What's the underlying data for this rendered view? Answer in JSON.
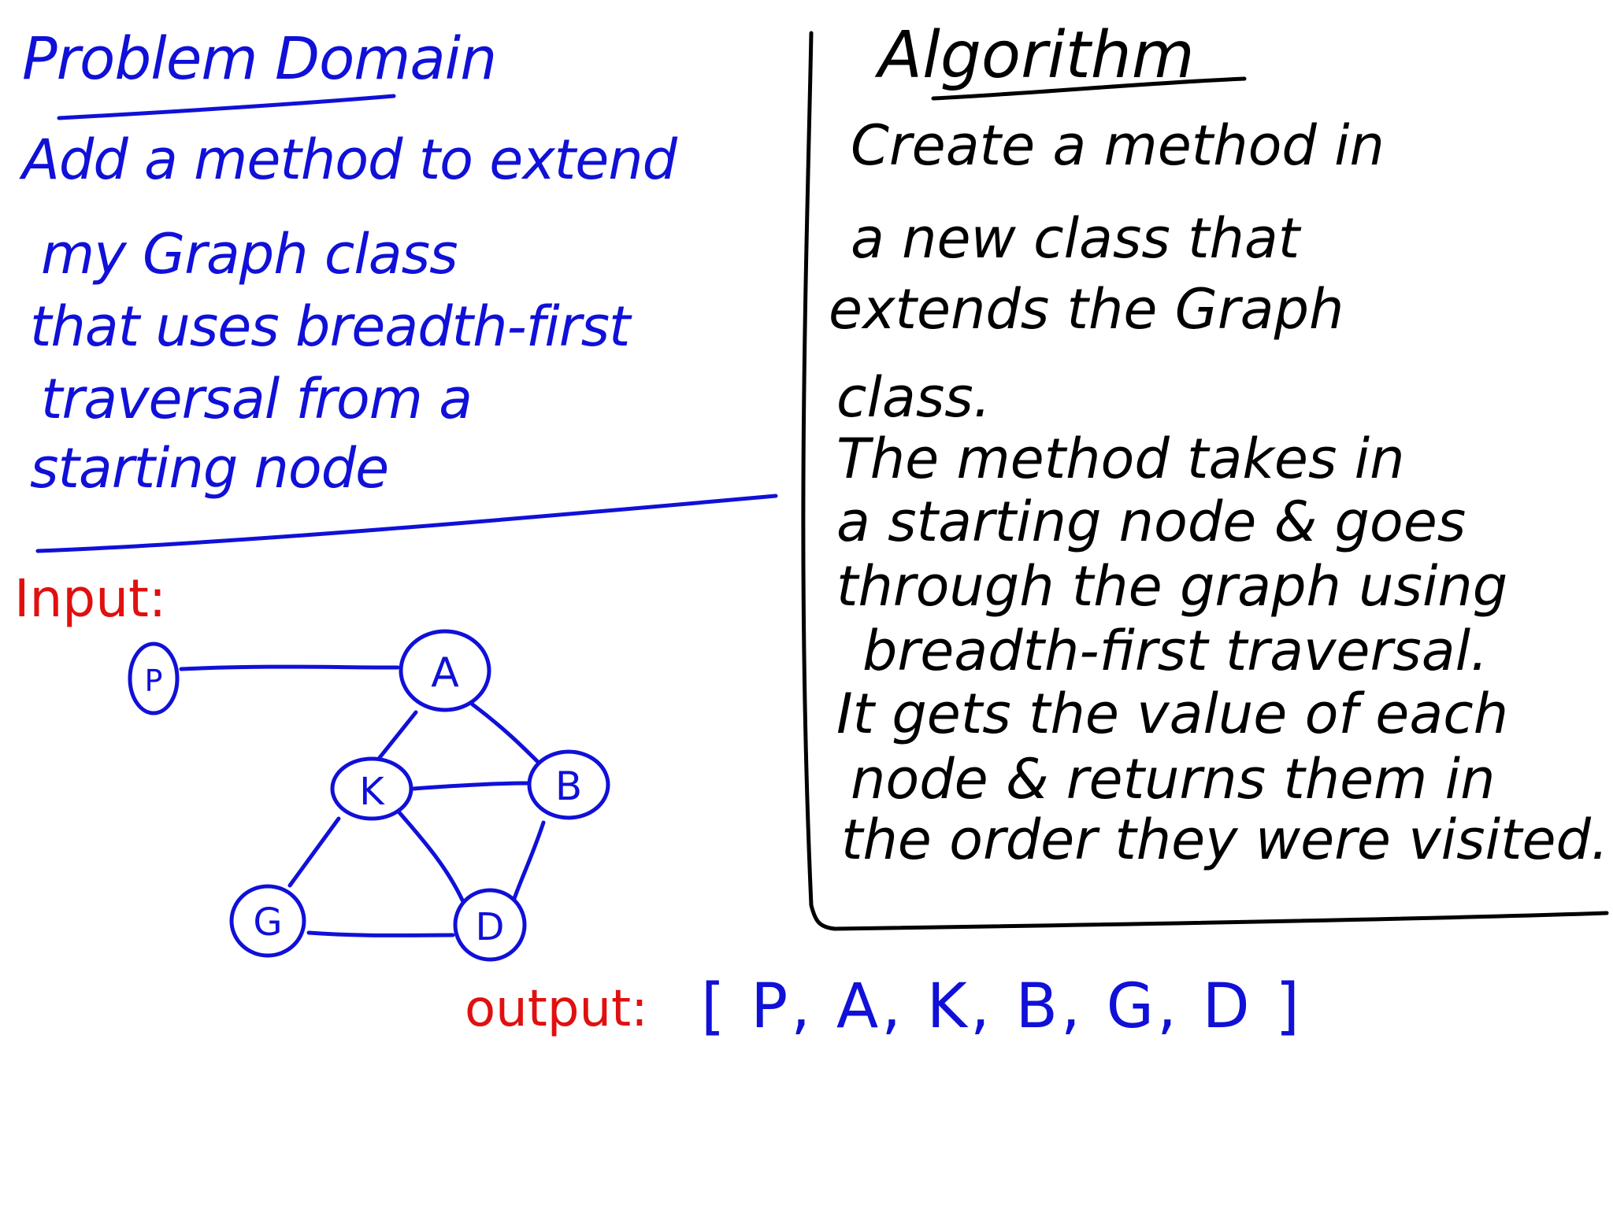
{
  "colors": {
    "ink_blue": "#1010d8",
    "ink_black": "#000000",
    "ink_red": "#e01010"
  },
  "problem_domain": {
    "title": "Problem Domain",
    "lines": [
      "Add a method to extend",
      "my Graph class",
      "that uses breadth-first",
      "traversal from a",
      "starting node"
    ]
  },
  "algorithm": {
    "title": "Algorithm",
    "lines": [
      "Create a method in",
      "a new class that",
      "extends the Graph",
      "class.",
      "The method takes in",
      "a starting node & goes",
      "through the graph using",
      "breadth-first traversal.",
      "It gets the value of each",
      "node & returns them in",
      "the order they were visited."
    ]
  },
  "input": {
    "label": "Input:",
    "nodes": [
      "P",
      "A",
      "K",
      "B",
      "G",
      "D"
    ],
    "edges": [
      [
        "P",
        "A"
      ],
      [
        "A",
        "K"
      ],
      [
        "A",
        "B"
      ],
      [
        "K",
        "B"
      ],
      [
        "K",
        "G"
      ],
      [
        "K",
        "D"
      ],
      [
        "B",
        "D"
      ],
      [
        "G",
        "D"
      ]
    ]
  },
  "output": {
    "label": "output:",
    "value": "[ P, A, K, B, G, D ]"
  }
}
